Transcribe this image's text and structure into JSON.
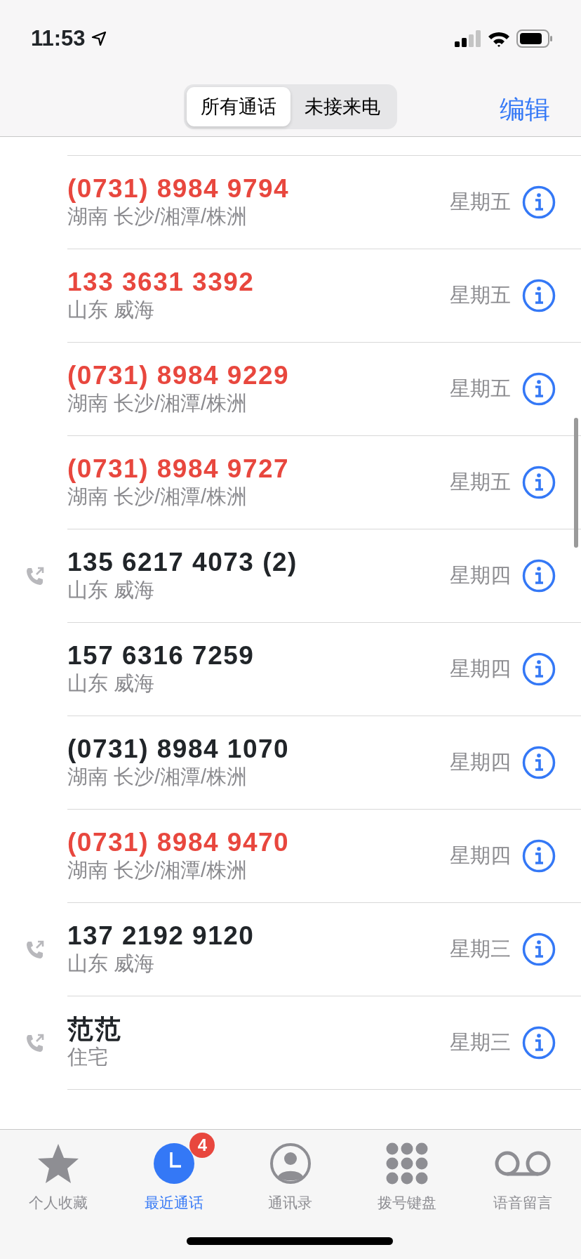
{
  "status_bar": {
    "time": "11:53"
  },
  "nav": {
    "segments": [
      {
        "label": "所有通话",
        "selected": true
      },
      {
        "label": "未接来电",
        "selected": false
      }
    ],
    "edit": "编辑"
  },
  "calls": [
    {
      "number": "(0731) 8984 9794",
      "place": "湖南 长沙/湘潭/株洲",
      "day": "星期五",
      "missed": true,
      "outgoing": false
    },
    {
      "number": "133 3631 3392",
      "place": "山东 威海",
      "day": "星期五",
      "missed": true,
      "outgoing": false
    },
    {
      "number": "(0731) 8984 9229",
      "place": "湖南 长沙/湘潭/株洲",
      "day": "星期五",
      "missed": true,
      "outgoing": false
    },
    {
      "number": "(0731) 8984 9727",
      "place": "湖南 长沙/湘潭/株洲",
      "day": "星期五",
      "missed": true,
      "outgoing": false
    },
    {
      "number": "135 6217 4073 (2)",
      "place": "山东 威海",
      "day": "星期四",
      "missed": false,
      "outgoing": true
    },
    {
      "number": "157 6316 7259",
      "place": "山东 威海",
      "day": "星期四",
      "missed": false,
      "outgoing": false
    },
    {
      "number": "(0731) 8984 1070",
      "place": "湖南 长沙/湘潭/株洲",
      "day": "星期四",
      "missed": false,
      "outgoing": false
    },
    {
      "number": "(0731) 8984 9470",
      "place": "湖南 长沙/湘潭/株洲",
      "day": "星期四",
      "missed": true,
      "outgoing": false
    },
    {
      "number": "137 2192 9120",
      "place": "山东 威海",
      "day": "星期三",
      "missed": false,
      "outgoing": true
    },
    {
      "number": "范范",
      "place": "住宅",
      "day": "星期三",
      "missed": false,
      "outgoing": true
    }
  ],
  "tab_bar": [
    {
      "kind": "star",
      "label": "个人收藏",
      "selected": false
    },
    {
      "kind": "clock",
      "label": "最近通话",
      "selected": true,
      "badge": "4"
    },
    {
      "kind": "contact",
      "label": "通讯录",
      "selected": false
    },
    {
      "kind": "keypad",
      "label": "拨号键盘",
      "selected": false
    },
    {
      "kind": "voicemail",
      "label": "语音留言",
      "selected": false
    }
  ]
}
